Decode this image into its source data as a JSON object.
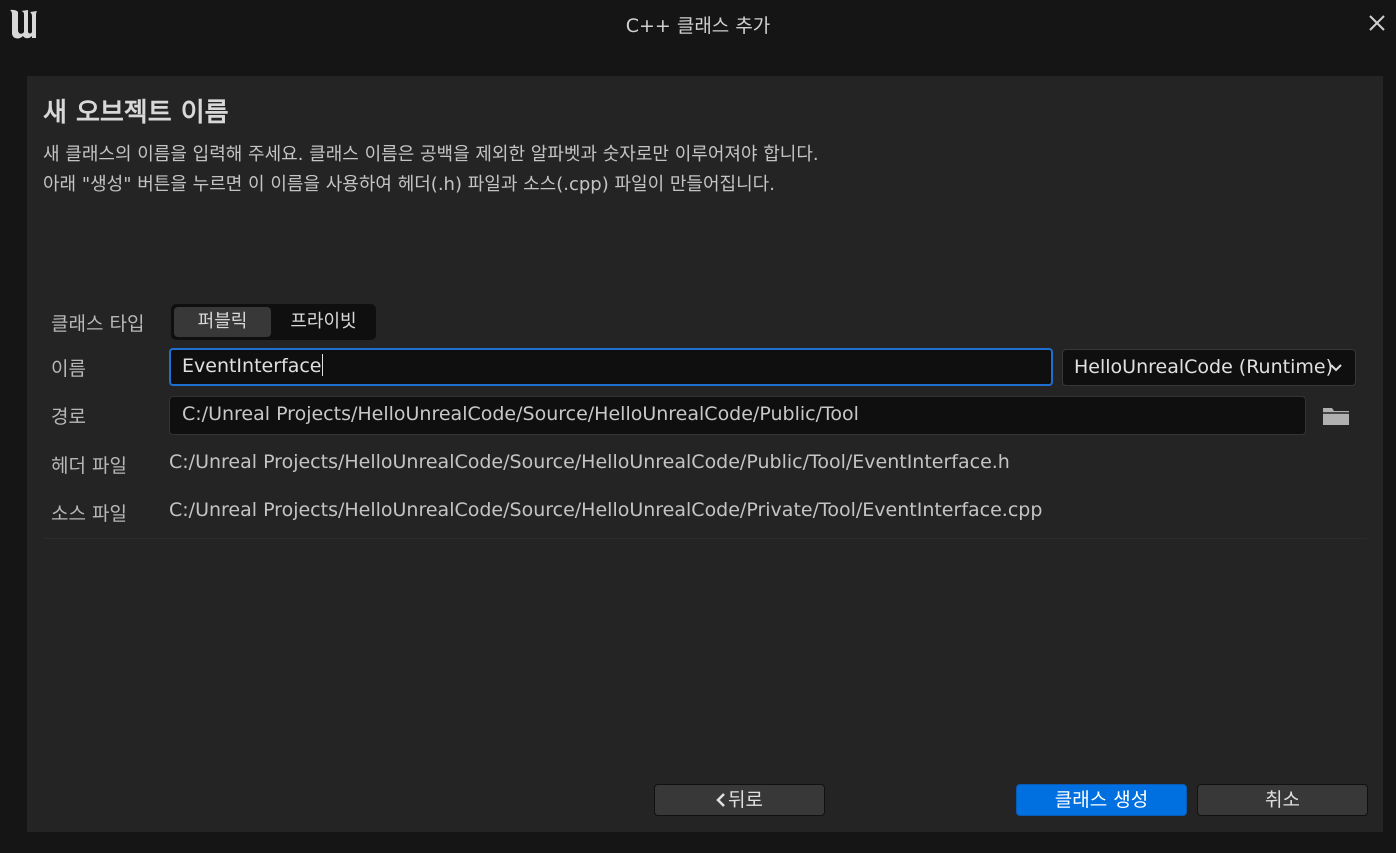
{
  "window": {
    "title": "C++ 클래스 추가",
    "logo_icon": "unreal-engine-logo",
    "close_icon": "close-icon"
  },
  "header": {
    "title": "새 오브젝트 이름",
    "description_line1": "새 클래스의 이름을 입력해 주세요. 클래스 이름은 공백을 제외한 알파벳과 숫자로만 이루어져야 합니다.",
    "description_line2": "아래 \"생성\" 버튼을 누르면 이 이름을 사용하여 헤더(.h) 파일과 소스(.cpp) 파일이 만들어집니다."
  },
  "form": {
    "class_type_label": "클래스 타입",
    "class_type_options": [
      "퍼블릭",
      "프라이빗"
    ],
    "class_type_selected": "퍼블릭",
    "name_label": "이름",
    "name_value": "EventInterface",
    "module_value": "HelloUnrealCode (Runtime)",
    "path_label": "경로",
    "path_value": "C:/Unreal Projects/HelloUnrealCode/Source/HelloUnrealCode/Public/Tool",
    "header_file_label": "헤더 파일",
    "header_file_value": "C:/Unreal Projects/HelloUnrealCode/Source/HelloUnrealCode/Public/Tool/EventInterface.h",
    "source_file_label": "소스 파일",
    "source_file_value": "C:/Unreal Projects/HelloUnrealCode/Source/HelloUnrealCode/Private/Tool/EventInterface.cpp"
  },
  "footer": {
    "back_label": "뒤로",
    "create_label": "클래스 생성",
    "cancel_label": "취소"
  },
  "colors": {
    "accent": "#0070e0",
    "focus_border": "#1f6fd1",
    "panel_bg": "#242424",
    "window_bg": "#151515"
  }
}
